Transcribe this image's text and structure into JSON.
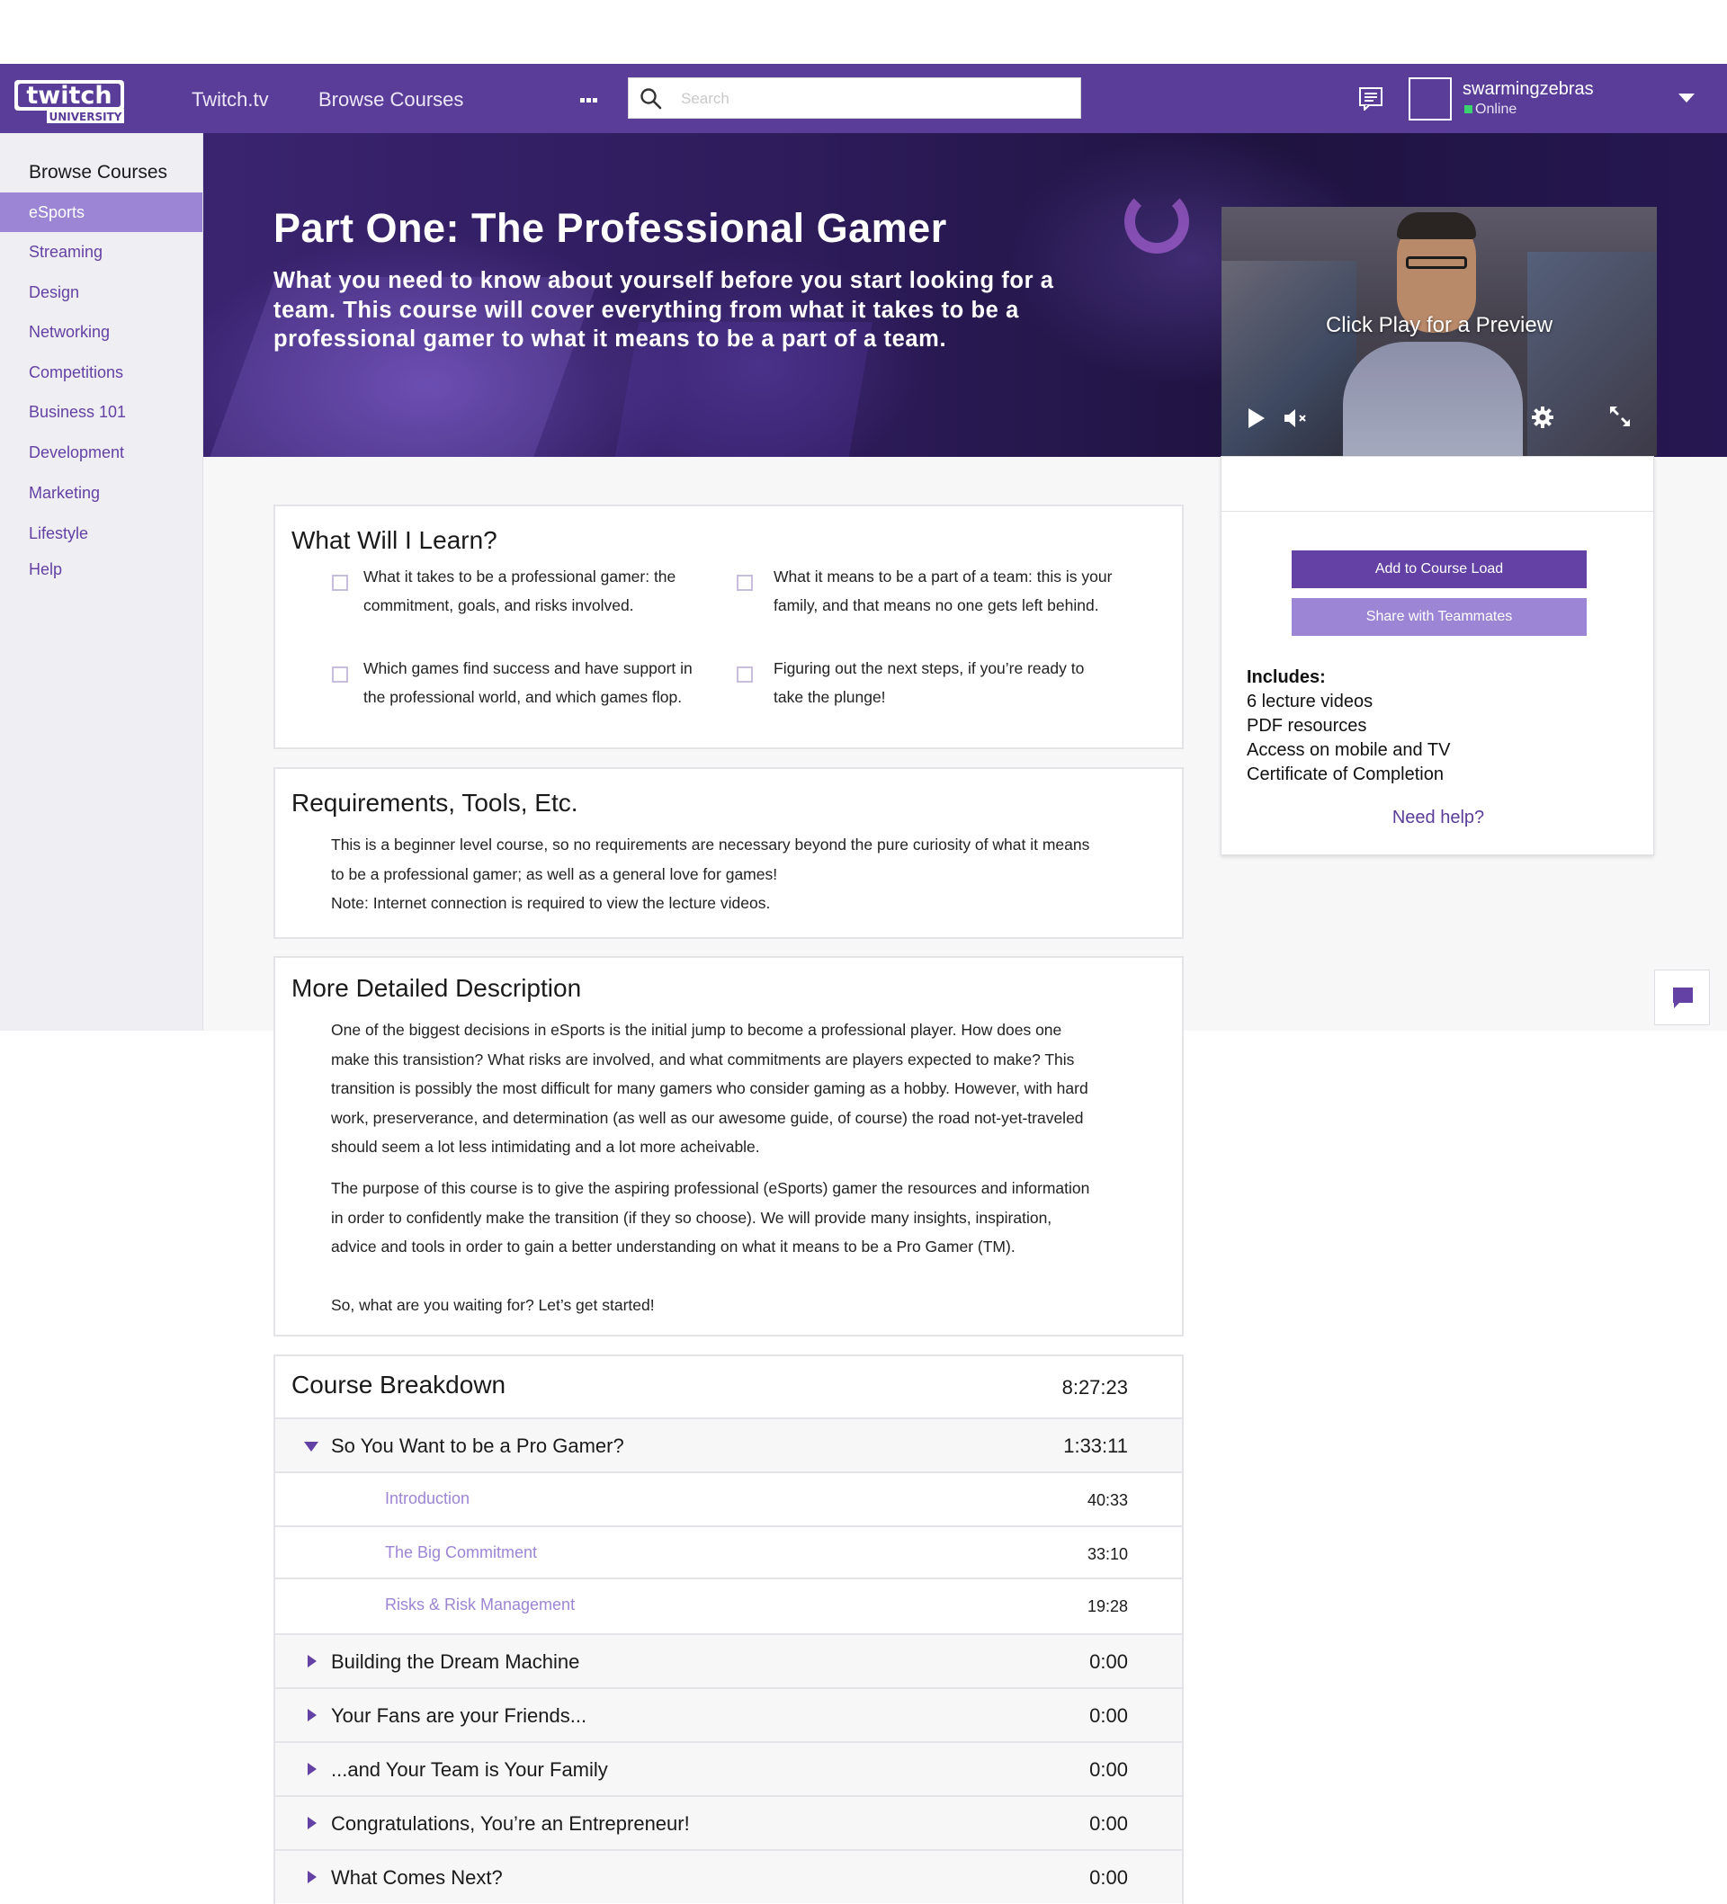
{
  "header": {
    "logo_text": "twitch UNIVERSITY",
    "nav": [
      "Twitch.tv",
      "Browse Courses"
    ],
    "search_placeholder": "Search",
    "username": "swarmingzebras",
    "status": "Online",
    "colors": {
      "bar": "#5a3d99",
      "accent": "#6441a4",
      "accent_light": "#9c85d4",
      "online": "#3bd16f"
    }
  },
  "sidebar": {
    "title": "Browse Courses",
    "items": [
      "eSports",
      "Streaming",
      "Design",
      "Networking",
      "Competitions",
      "Business 101",
      "Development",
      "Marketing",
      "Lifestyle",
      "Help"
    ],
    "active_item": "eSports"
  },
  "hero": {
    "title": "Part One: The Professional Gamer",
    "subtitle_lines": [
      "What you need to know about yourself before you start looking for a",
      "team. This course will cover everything from what it takes to be a",
      "professional gamer to what it means to be a part of a team."
    ]
  },
  "preview": {
    "caption": "Click Play for a Preview",
    "icons": [
      "play-icon",
      "mute-icon",
      "settings-gear-icon",
      "fullscreen-icon"
    ]
  },
  "actions": {
    "add_label": "Add to Course Load",
    "share_label": "Share with Teammates",
    "includes_heading": "Includes:",
    "includes": [
      "6 lecture videos",
      "PDF resources",
      "Access on mobile and TV",
      "Certificate of Completion"
    ],
    "help_link": "Need help?"
  },
  "learn": {
    "heading": "What Will I Learn?",
    "items": [
      [
        "What it takes to be a professional gamer: the",
        "commitment, goals, and risks involved."
      ],
      [
        "What it means to be a part of a team: this is your",
        "family, and that means no one gets left behind."
      ],
      [
        "Which games find success and have support in",
        "the professional world, and which games flop."
      ],
      [
        "Figuring out the next steps, if you’re ready to",
        "take the plunge!"
      ]
    ]
  },
  "requirements": {
    "heading": "Requirements, Tools, Etc.",
    "lines": [
      "This is a beginner level course, so no requirements are necessary beyond the pure curiosity of what it means",
      "to be a professional gamer; as well as a general love for games!",
      "Note: Internet connection is required to view the lecture videos."
    ]
  },
  "description": {
    "heading": "More Detailed Description",
    "p1": [
      "One of the biggest decisions in eSports is the initial jump to become a professional player. How does one",
      "make this transistion? What risks are involved, and what commitments are players expected to make? This",
      "transition is possibly the most difficult for many gamers who consider gaming as a hobby. However, with hard",
      "work, preserverance, and determination (as well as our awesome guide, of course) the road not-yet-traveled",
      "should seem a lot less intimidating and a lot more acheivable."
    ],
    "p2": [
      "The purpose of this course is to give the aspiring professional (eSports) gamer the resources and information",
      "in order to confidently make the transition (if they so choose). We will provide many insights, inspiration,",
      "advice and tools in order to gain a better understanding on what it means to be a Pro Gamer (TM)."
    ],
    "p3": "So, what are you waiting for? Let’s get started!"
  },
  "breakdown": {
    "heading": "Course Breakdown",
    "total": "8:27:23",
    "sections": [
      {
        "title": "So You Want to be a Pro Gamer?",
        "time": "1:33:11",
        "expanded": true,
        "lectures": [
          {
            "title": "Introduction",
            "time": "40:33"
          },
          {
            "title": "The Big Commitment",
            "time": "33:10"
          },
          {
            "title": "Risks & Risk Management",
            "time": "19:28"
          }
        ]
      },
      {
        "title": "Building the Dream Machine",
        "time": "0:00"
      },
      {
        "title": "Your Fans are your Friends...",
        "time": "0:00"
      },
      {
        "title": "...and Your Team is Your Family",
        "time": "0:00"
      },
      {
        "title": "Congratulations, You’re an Entrepreneur!",
        "time": "0:00"
      },
      {
        "title": "What Comes Next?",
        "time": "0:00"
      }
    ]
  }
}
